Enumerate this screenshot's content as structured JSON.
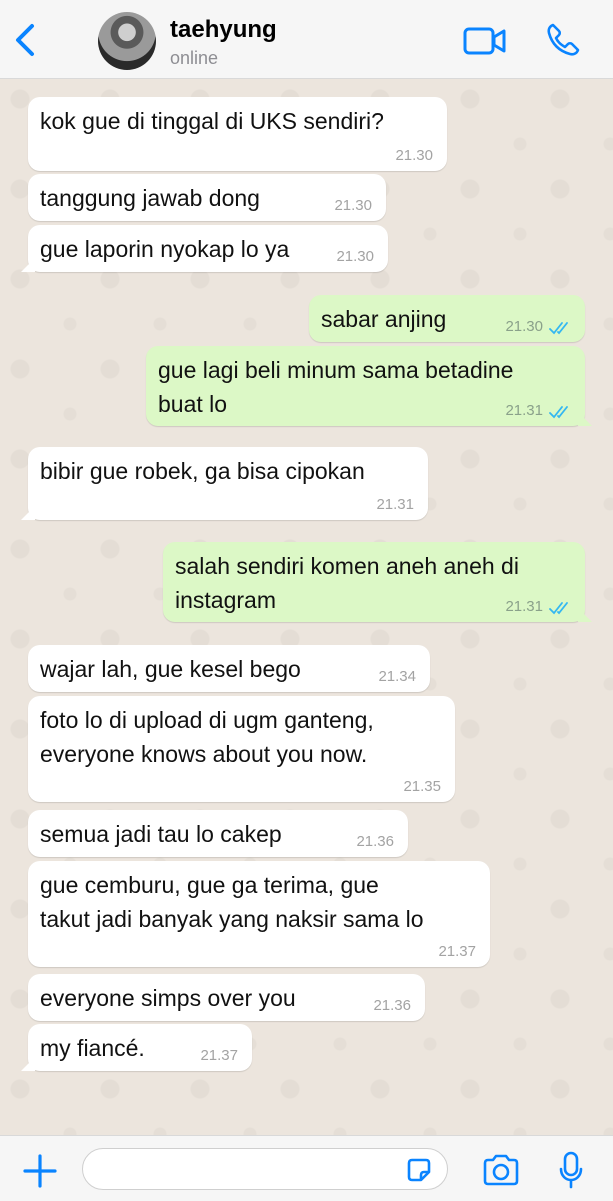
{
  "header": {
    "contact_name": "taehyung",
    "status": "online"
  },
  "colors": {
    "accent": "#0a84ff",
    "incoming_bubble": "#ffffff",
    "outgoing_bubble": "#dcf8c6",
    "read_ticks": "#34b7f1"
  },
  "messages": [
    {
      "direction": "incoming",
      "text": "kok gue di tinggal di UKS sendiri?",
      "time": "21.30"
    },
    {
      "direction": "incoming",
      "text": "tanggung jawab dong",
      "time": "21.30"
    },
    {
      "direction": "incoming",
      "text": "gue laporin nyokap lo ya",
      "time": "21.30"
    },
    {
      "direction": "outgoing",
      "text": "sabar anjing",
      "time": "21.30",
      "status": "read"
    },
    {
      "direction": "outgoing",
      "text": "gue lagi beli minum sama betadine\nbuat lo",
      "time": "21.31",
      "status": "read"
    },
    {
      "direction": "incoming",
      "text": "bibir gue robek, ga bisa cipokan",
      "time": "21.31"
    },
    {
      "direction": "outgoing",
      "text": "salah sendiri komen aneh aneh di\ninstagram",
      "time": "21.31",
      "status": "read"
    },
    {
      "direction": "incoming",
      "text": "wajar lah, gue kesel bego",
      "time": "21.34"
    },
    {
      "direction": "incoming",
      "text": "foto lo di upload di ugm ganteng,\neveryone knows about you now.",
      "time": "21.35"
    },
    {
      "direction": "incoming",
      "text": "semua jadi tau lo cakep",
      "time": "21.36"
    },
    {
      "direction": "incoming",
      "text": "gue cemburu, gue ga terima, gue\ntakut jadi banyak yang naksir sama lo",
      "time": "21.37"
    },
    {
      "direction": "incoming",
      "text": "everyone simps over you",
      "time": "21.36"
    },
    {
      "direction": "incoming",
      "text": "my fiancé.",
      "time": "21.37"
    }
  ],
  "composer": {
    "input_value": ""
  },
  "icons": {
    "back": "chevron-left-icon",
    "video": "video-camera-icon",
    "call": "phone-icon",
    "add": "plus-icon",
    "sticker": "sticker-icon",
    "camera": "camera-icon",
    "mic": "microphone-icon"
  }
}
